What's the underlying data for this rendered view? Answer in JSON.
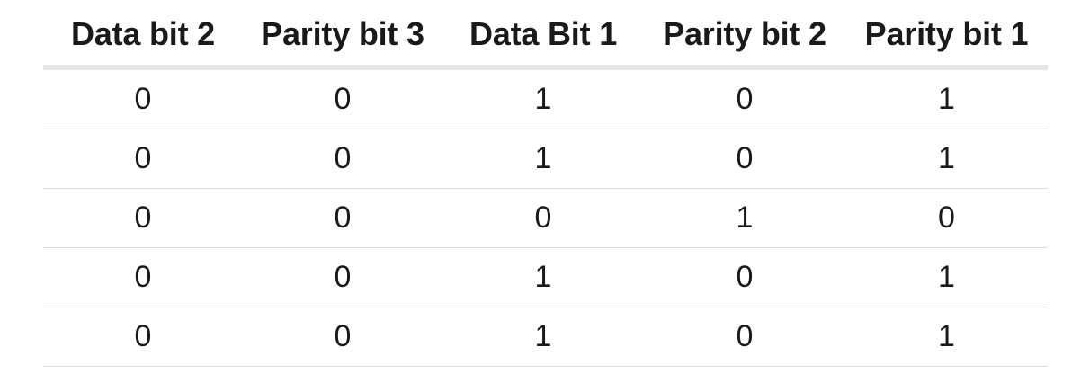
{
  "table": {
    "headers": [
      "Data bit 2",
      "Parity bit 3",
      "Data Bit 1",
      "Parity bit 2",
      "Parity bit 1"
    ],
    "rows": [
      [
        "0",
        "0",
        "1",
        "0",
        "1"
      ],
      [
        "0",
        "0",
        "1",
        "0",
        "1"
      ],
      [
        "0",
        "0",
        "0",
        "1",
        "0"
      ],
      [
        "0",
        "0",
        "1",
        "0",
        "1"
      ],
      [
        "0",
        "0",
        "1",
        "0",
        "1"
      ]
    ]
  }
}
